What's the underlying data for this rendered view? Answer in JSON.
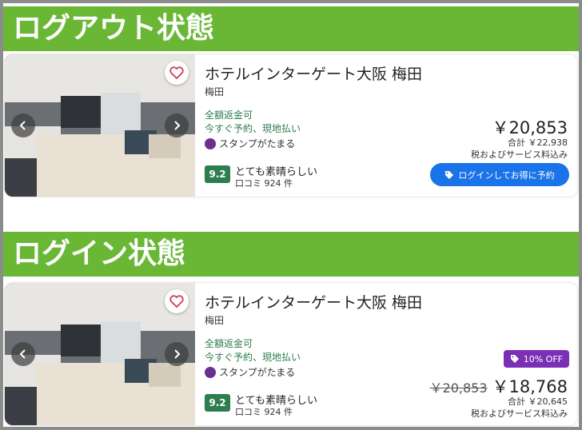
{
  "sections": [
    {
      "heading": "ログアウト状態",
      "card": {
        "hotel_name": "ホテルインターゲート大阪 梅田",
        "area": "梅田",
        "refund": "全額返金可",
        "pay_later": "今すぐ予約、現地払い",
        "stamp": "スタンプがたまる",
        "score": "9.2",
        "score_label": "とても素晴らしい",
        "reviews": "口コミ 924 件",
        "price": "￥20,853",
        "total": "合計 ￥22,938",
        "tax_note": "税およびサービス料込み",
        "login_button": "ログインしてお得に予約"
      }
    },
    {
      "heading": "ログイン状態",
      "card": {
        "hotel_name": "ホテルインターゲート大阪 梅田",
        "area": "梅田",
        "refund": "全額返金可",
        "pay_later": "今すぐ予約、現地払い",
        "stamp": "スタンプがたまる",
        "score": "9.2",
        "score_label": "とても素晴らしい",
        "reviews": "口コミ 924 件",
        "discount_badge": "10% OFF",
        "old_price": "￥20,853",
        "price": "￥18,768",
        "total": "合計 ￥20,645",
        "tax_note": "税およびサービス料込み"
      }
    }
  ],
  "colors": {
    "banner_green": "#6ab736",
    "score_green": "#2e7d4f",
    "button_blue": "#1a73e8",
    "discount_purple": "#7b2fb5"
  }
}
